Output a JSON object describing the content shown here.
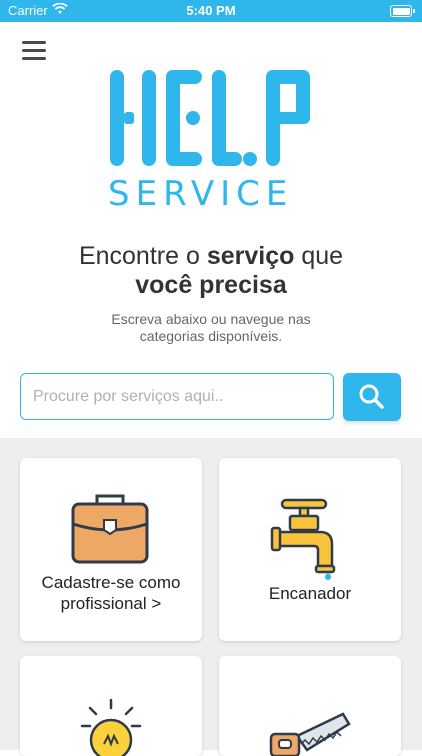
{
  "status_bar": {
    "carrier": "Carrier",
    "time": "5:40 PM"
  },
  "logo": {
    "main": "HELP",
    "sub": "SERVICE"
  },
  "headline": {
    "part1": "Encontre o ",
    "bold1": "serviço",
    "part2": " que",
    "bold2": "você precisa"
  },
  "subtitle": {
    "line1": "Escreva abaixo ou navegue nas",
    "line2": "categorias disponíveis."
  },
  "search": {
    "placeholder": "Procure por serviços aqui..",
    "icon": "search-icon"
  },
  "categories": [
    {
      "label_line1": "Cadastre-se como",
      "label_line2": "profissional >",
      "icon": "briefcase-icon"
    },
    {
      "label_line1": "Encanador",
      "label_line2": "",
      "icon": "faucet-icon"
    },
    {
      "label_line1": "",
      "label_line2": "",
      "icon": "lightbulb-icon"
    },
    {
      "label_line1": "",
      "label_line2": "",
      "icon": "saw-icon"
    }
  ],
  "colors": {
    "primary": "#2fb6ea",
    "briefcase": "#eea866",
    "faucet": "#f8c43c",
    "bulb": "#fbd23c"
  }
}
